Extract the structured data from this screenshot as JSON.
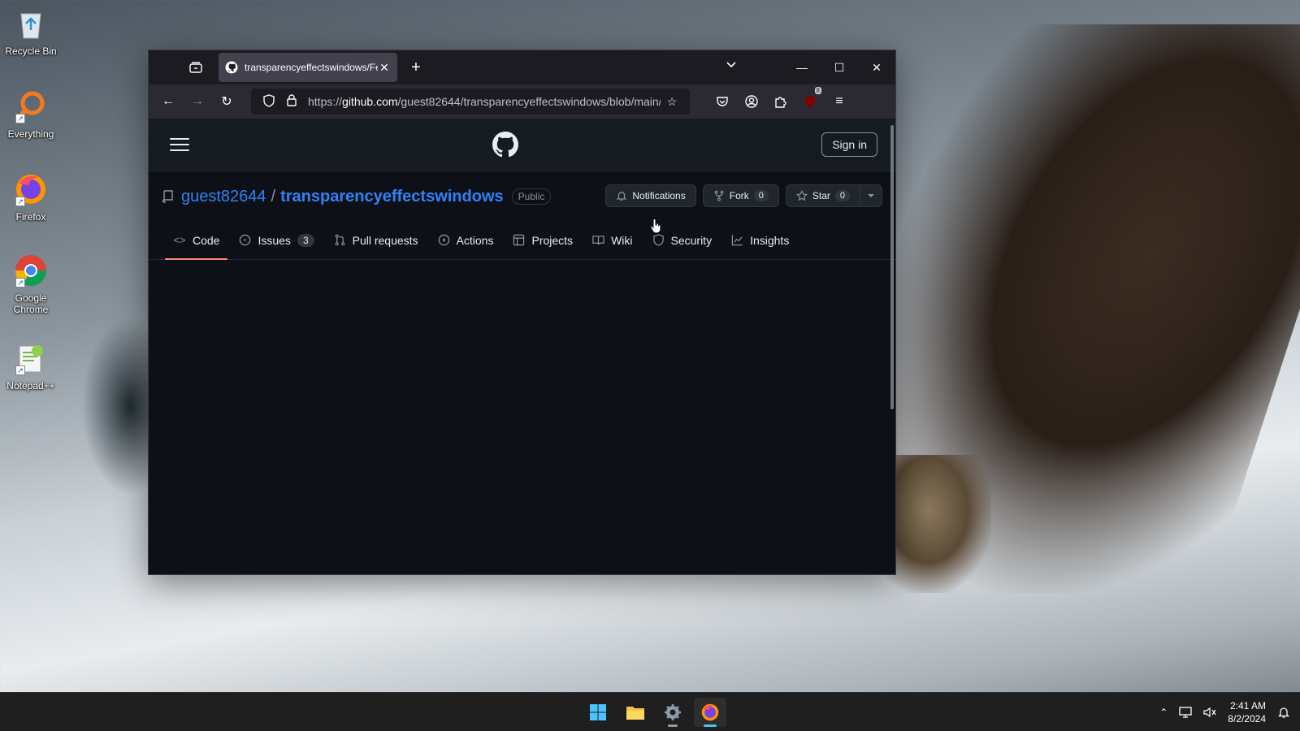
{
  "desktop": {
    "icons": [
      {
        "label": "Recycle Bin",
        "icon": "recycle-bin-icon"
      },
      {
        "label": "Everything",
        "icon": "everything-search-icon"
      },
      {
        "label": "Firefox",
        "icon": "firefox-icon"
      },
      {
        "label": "Google Chrome",
        "icon": "chrome-icon"
      },
      {
        "label": "Notepad++",
        "icon": "notepadpp-icon"
      }
    ]
  },
  "browser": {
    "tab_title": "transparencyeffectswindows/Fe",
    "url_prefix": "https://",
    "url_host": "github.com",
    "url_path": "/guest82644/transparencyeffectswindows/blob/main/",
    "extension_badge": "8"
  },
  "github": {
    "sign_in": "Sign in",
    "owner": "guest82644",
    "separator": "/",
    "repo": "transparencyeffectswindows",
    "visibility": "Public",
    "actions": {
      "notifications": "Notifications",
      "fork": "Fork",
      "fork_count": "0",
      "star": "Star",
      "star_count": "0"
    },
    "tabs": [
      {
        "label": "Code",
        "icon": "code-icon",
        "active": true
      },
      {
        "label": "Issues",
        "icon": "issue-icon",
        "count": "3"
      },
      {
        "label": "Pull requests",
        "icon": "pull-request-icon"
      },
      {
        "label": "Actions",
        "icon": "play-icon"
      },
      {
        "label": "Projects",
        "icon": "table-icon"
      },
      {
        "label": "Wiki",
        "icon": "book-icon"
      },
      {
        "label": "Security",
        "icon": "shield-icon"
      },
      {
        "label": "Insights",
        "icon": "graph-icon"
      }
    ]
  },
  "taskbar": {
    "time": "2:41 AM",
    "date": "8/2/2024",
    "apps": [
      "start-icon",
      "file-explorer-icon",
      "settings-icon",
      "firefox-icon"
    ]
  },
  "colors": {
    "github_bg": "#0d1117",
    "link_blue": "#2f81f7",
    "active_tab_underline": "#fd8c73"
  }
}
